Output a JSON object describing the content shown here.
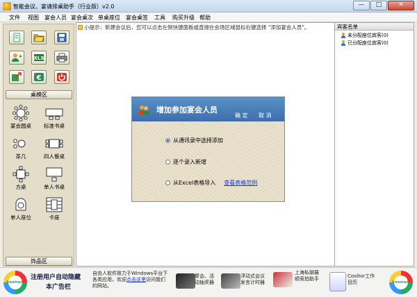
{
  "window": {
    "title": "智能会议、宴请排桌助手（行业版）v2.0",
    "minimize": "—",
    "maximize": "□",
    "close": "✕"
  },
  "menu": [
    "文件",
    "视图",
    "宴会人员",
    "宴会桌次",
    "单桌座位",
    "宴会桌签",
    "工具",
    "购买升级",
    "帮助"
  ],
  "hint": "小提示：新建会议后，您可以点击左侧快捷面板或直接在会场区域鼠标右键选择 \"添加宴会人员\"。",
  "left_panel": {
    "quick_buttons": [
      {
        "name": "new-icon"
      },
      {
        "name": "open-folder-icon"
      },
      {
        "name": "save-icon"
      },
      {
        "name": "add-person-icon"
      },
      {
        "name": "excel-icon"
      },
      {
        "name": "print-icon"
      },
      {
        "name": "export-icon"
      },
      {
        "name": "currency-icon"
      },
      {
        "name": "power-icon"
      }
    ],
    "section_tables": "桌模区",
    "section_decor": "饰品区",
    "tools": [
      {
        "label": "宴会圆桌",
        "icon": "round-table-icon"
      },
      {
        "label": "标准书桌",
        "icon": "desk-icon"
      },
      {
        "label": "茶几",
        "icon": "tea-table-icon"
      },
      {
        "label": "四人餐桌",
        "icon": "four-seat-table-icon"
      },
      {
        "label": "方桌",
        "icon": "square-table-icon"
      },
      {
        "label": "单人书桌",
        "icon": "single-desk-icon"
      },
      {
        "label": "单人座位",
        "icon": "single-seat-icon"
      },
      {
        "label": "卡座",
        "icon": "booth-icon"
      }
    ]
  },
  "right_panel": {
    "header": "宾客名单",
    "items": [
      "未分配座位宾客(0)",
      "已分配座位宾客(0)"
    ]
  },
  "dialog": {
    "title": "增加参加宴会人员",
    "confirm": "确 定",
    "cancel": "取 消",
    "options": [
      "从通讯录中选择添加",
      "逐个录入新增",
      "从Excel表格导入"
    ],
    "selected_option": 0,
    "excel_link": "查看表格范例"
  },
  "status_bar": {
    "logo_text": "freeman",
    "ad_title_1": "注册用户自动隐藏",
    "ad_title_2": "本广告栏",
    "ad_desc_1": "自由人软件致力于Windows平台下",
    "ad_desc_2a": "各类应用，欢迎",
    "ad_desc_link": "点击这里",
    "ad_desc_2b": "访问我们",
    "ad_desc_3": "的网站。",
    "promos": [
      {
        "line1": "聚会、活",
        "line2": "动抽奖器"
      },
      {
        "line1": "浮动式会议",
        "line2": "发言计时器"
      },
      {
        "line1": "上海私",
        "line2": "聊展",
        "line3": "顺竞拍",
        "line4": "助手"
      },
      {
        "line1": "Cooltor",
        "line2": "工作",
        "line3": "目历"
      }
    ]
  },
  "colors": {
    "dialog_header": "#4a7fbb",
    "panel_bg": "#e4ddc9",
    "link": "#1a3fcc"
  }
}
